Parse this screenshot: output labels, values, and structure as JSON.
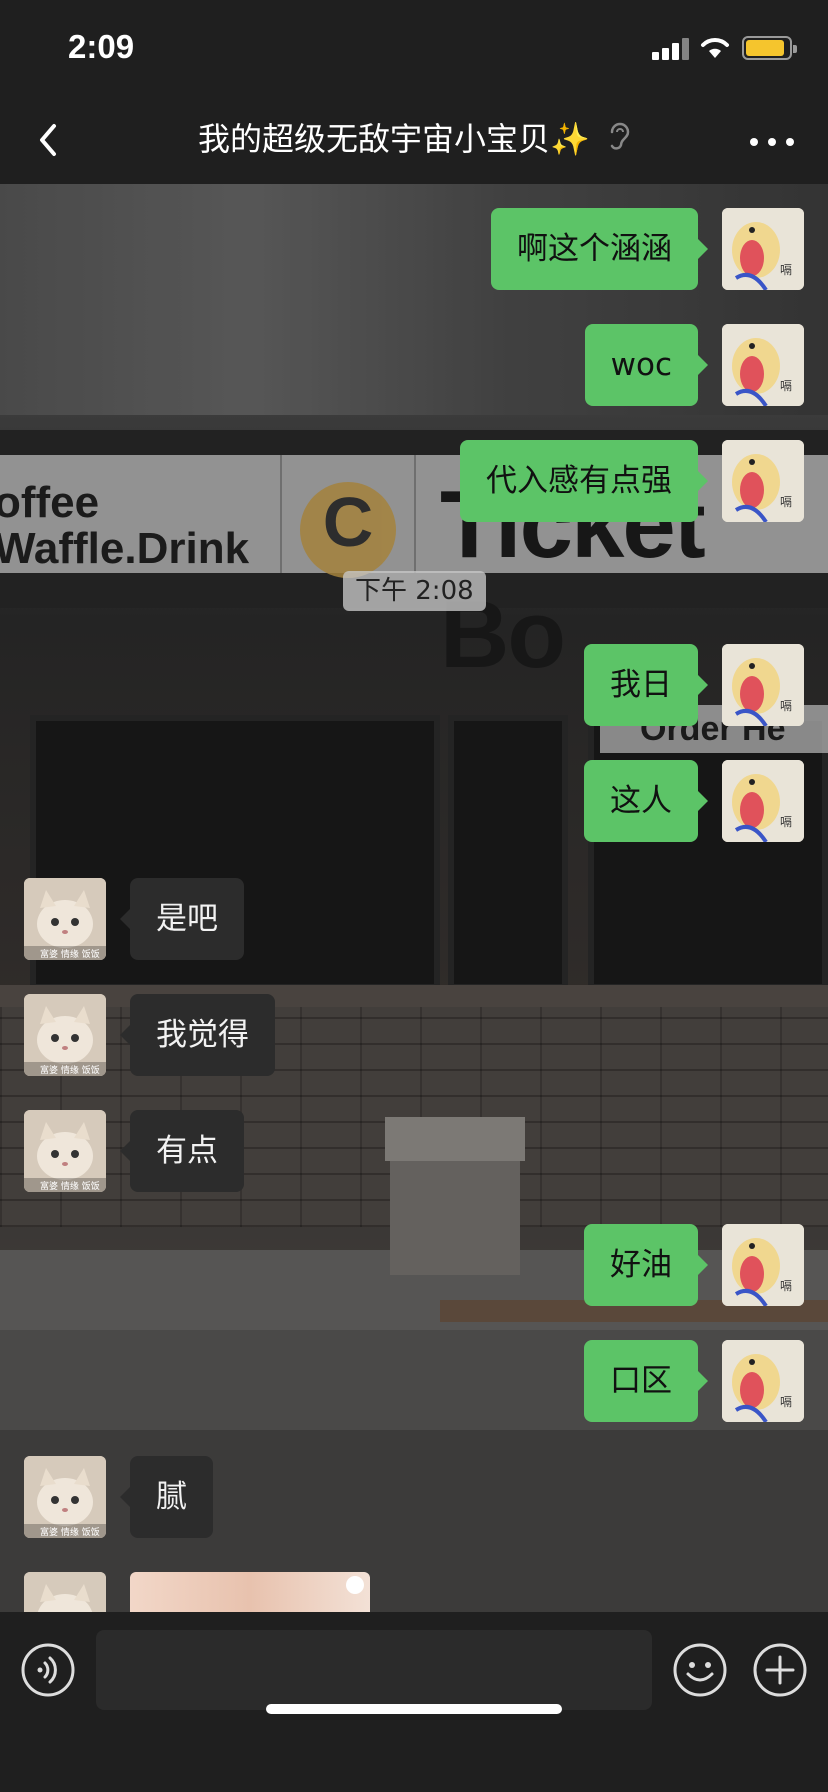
{
  "status_bar": {
    "time": "2:09",
    "battery_color": "#f5c52d"
  },
  "header": {
    "title": "我的超级无敌宇宙小宝贝✨",
    "back_icon": "chevron-left-icon",
    "mute_icon": "ear-muted-icon",
    "more_icon": "more-dots-icon"
  },
  "background": {
    "sign_left_line1": "offee",
    "sign_left_line2": "Waffle.Drink",
    "sign_logo": "C",
    "sign_right": "Ticket Bo",
    "order_sign": "Order He"
  },
  "avatars": {
    "self": "duck-sticker-avatar",
    "other": "cat-avatar",
    "self_avatar_text": "嗝",
    "other_avatar_text": "富婆 情缘 饭饭"
  },
  "messages": [
    {
      "side": "out",
      "text": "啊这个涵涵"
    },
    {
      "side": "out",
      "text": "woc"
    },
    {
      "side": "out",
      "text": "代入感有点强"
    },
    {
      "side": "time",
      "text": "下午 2:08"
    },
    {
      "side": "out",
      "text": "我日"
    },
    {
      "side": "out",
      "text": "这人"
    },
    {
      "side": "in",
      "text": "是吧"
    },
    {
      "side": "in",
      "text": "我觉得"
    },
    {
      "side": "in",
      "text": "有点"
    },
    {
      "side": "out",
      "text": "好油"
    },
    {
      "side": "out",
      "text": "口区"
    },
    {
      "side": "in",
      "text": "腻"
    }
  ],
  "input": {
    "value": "",
    "placeholder": ""
  },
  "colors": {
    "outgoing_bubble": "#5cc467",
    "incoming_bubble": "#2c2c2c",
    "bar": "#1f1f1f"
  }
}
